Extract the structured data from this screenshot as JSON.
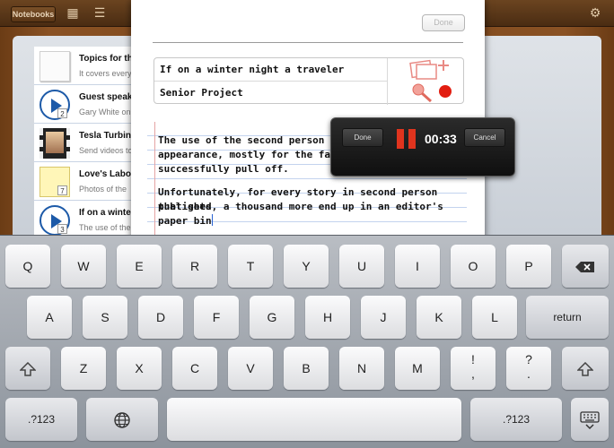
{
  "toolbar": {
    "back_label": "Notebooks",
    "done_label": "Done"
  },
  "doc_list": [
    {
      "title": "Topics for the",
      "subtitle": "It covers every",
      "thumb": "paper",
      "badge": ""
    },
    {
      "title": "Guest speaker",
      "subtitle": "Gary White on",
      "thumb": "play",
      "badge": "2"
    },
    {
      "title": "Tesla Turbine",
      "subtitle": "Send videos to",
      "thumb": "film",
      "badge": ""
    },
    {
      "title": "Love's Labours",
      "subtitle": "Photos of the",
      "thumb": "note",
      "badge": "7"
    },
    {
      "title": "If on a winter",
      "subtitle": "The use of the",
      "thumb": "play",
      "badge": "3"
    }
  ],
  "projects": [
    {
      "label": "If on a winter night a traveler",
      "icon": "photos-add-icon"
    },
    {
      "label": "Senior Project",
      "icon": "microphone-record-icon"
    }
  ],
  "document": {
    "para1_line1": "The use of the second person in a narra",
    "para1_line2": "appearance, mostly for the fact that it",
    "para1_line3": "successfully pull off.",
    "para2_line1": "Unfortunately, for every story in second person that gets",
    "para2_line2": "published, a thousand more end up in an editor's paper bin"
  },
  "recorder": {
    "done_label": "Done",
    "time": "00:33",
    "cancel_label": "Cancel"
  },
  "keyboard": {
    "row1": [
      "Q",
      "W",
      "E",
      "R",
      "T",
      "Y",
      "U",
      "I",
      "O",
      "P"
    ],
    "row2": [
      "A",
      "S",
      "D",
      "F",
      "G",
      "H",
      "J",
      "K",
      "L"
    ],
    "row3": [
      "Z",
      "X",
      "C",
      "V",
      "B",
      "N",
      "M"
    ],
    "return_label": "return",
    "num_label": ".?123",
    "excl_top": "!",
    "excl_bottom": ",",
    "q_top": "?",
    "q_bottom": "."
  },
  "colors": {
    "record_red": "#e0341e",
    "text_caret": "#2a64d4"
  }
}
